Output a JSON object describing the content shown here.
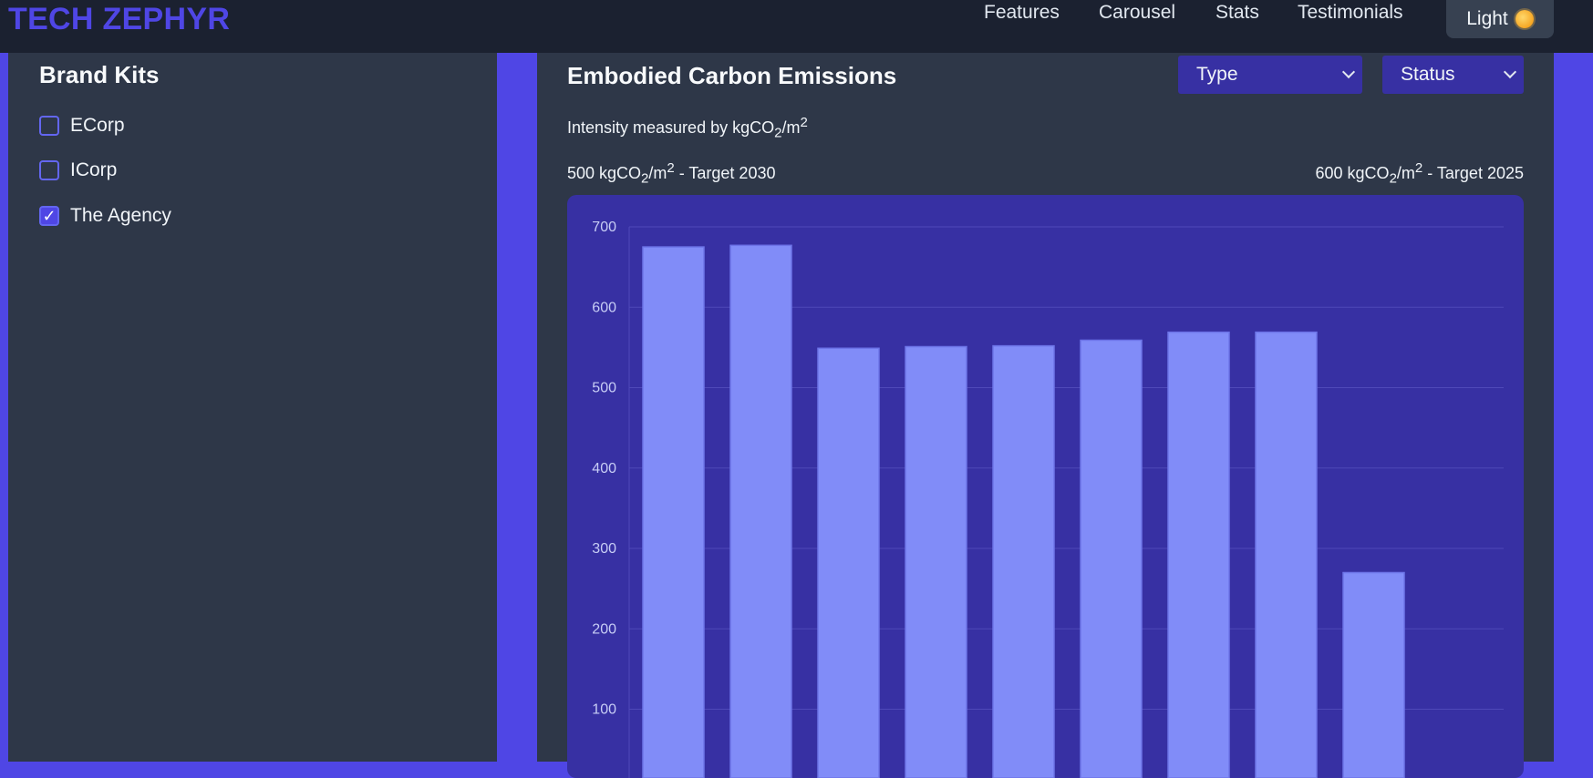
{
  "header": {
    "brand": "TECH ZEPHYR",
    "nav": [
      "Features",
      "Carousel",
      "Stats",
      "Testimonials"
    ],
    "theme_toggle": "Light"
  },
  "sidebar": {
    "title": "Brand Kits",
    "items": [
      {
        "label": "ECorp",
        "checked": false
      },
      {
        "label": "ICorp",
        "checked": false
      },
      {
        "label": "The Agency",
        "checked": true
      }
    ]
  },
  "main": {
    "title": "Embodied Carbon Emissions",
    "filters": {
      "type": "Type",
      "status": "Status"
    },
    "intensity": {
      "prefix": "Intensity measured by kgCO",
      "sub": "2",
      "mid": "/m",
      "sup": "2"
    },
    "target_left": {
      "value": "500 kgCO",
      "sub": "2",
      "mid": "/m",
      "sup": "2",
      "suffix": " - Target 2030"
    },
    "target_right": {
      "value": "600 kgCO",
      "sub": "2",
      "mid": "/m",
      "sup": "2",
      "suffix": " - Target 2025"
    }
  },
  "colors": {
    "accent": "#4f46e5",
    "panel": "#2e3748",
    "chart_bg": "#3730a3",
    "bar": "#818cf8"
  },
  "chart_data": {
    "type": "bar",
    "values": [
      675,
      677,
      549,
      551,
      552,
      559,
      569,
      569,
      270
    ],
    "yticks": [
      100,
      200,
      300,
      400,
      500,
      600,
      700
    ],
    "ylim": [
      0,
      700
    ],
    "grid": true
  }
}
